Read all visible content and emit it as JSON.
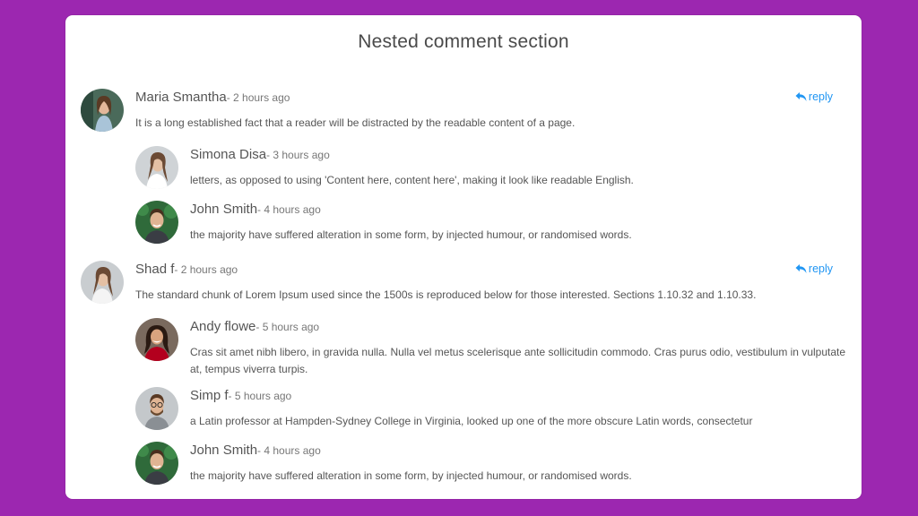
{
  "section": {
    "title": "Nested comment section",
    "reply_label": "reply",
    "accent_color": "#2196f3",
    "background_color": "#9c27b0"
  },
  "comments": [
    {
      "name": "Maria Smantha",
      "time": "- 2 hours ago",
      "text": "It is a long established fact that a reader will be distracted by the readable content of a page.",
      "replies": [
        {
          "name": "Simona Disa",
          "time": "- 3 hours ago",
          "text": "letters, as opposed to using 'Content here, content here', making it look like readable English."
        },
        {
          "name": "John Smith",
          "time": "- 4 hours ago",
          "text": "the majority have suffered alteration in some form, by injected humour, or randomised words."
        }
      ]
    },
    {
      "name": "Shad f",
      "time": "- 2 hours ago",
      "text": "The standard chunk of Lorem Ipsum used since the 1500s is reproduced below for those interested. Sections 1.10.32 and 1.10.33.",
      "replies": [
        {
          "name": "Andy flowe",
          "time": "- 5 hours ago",
          "text": "Cras sit amet nibh libero, in gravida nulla. Nulla vel metus scelerisque ante sollicitudin commodo. Cras purus odio, vestibulum in vulputate at, tempus viverra turpis."
        },
        {
          "name": "Simp f",
          "time": "- 5 hours ago",
          "text": "a Latin professor at Hampden-Sydney College in Virginia, looked up one of the more obscure Latin words, consectetur"
        },
        {
          "name": "John Smith",
          "time": "- 4 hours ago",
          "text": "the majority have suffered alteration in some form, by injected humour, or randomised words."
        }
      ]
    }
  ]
}
